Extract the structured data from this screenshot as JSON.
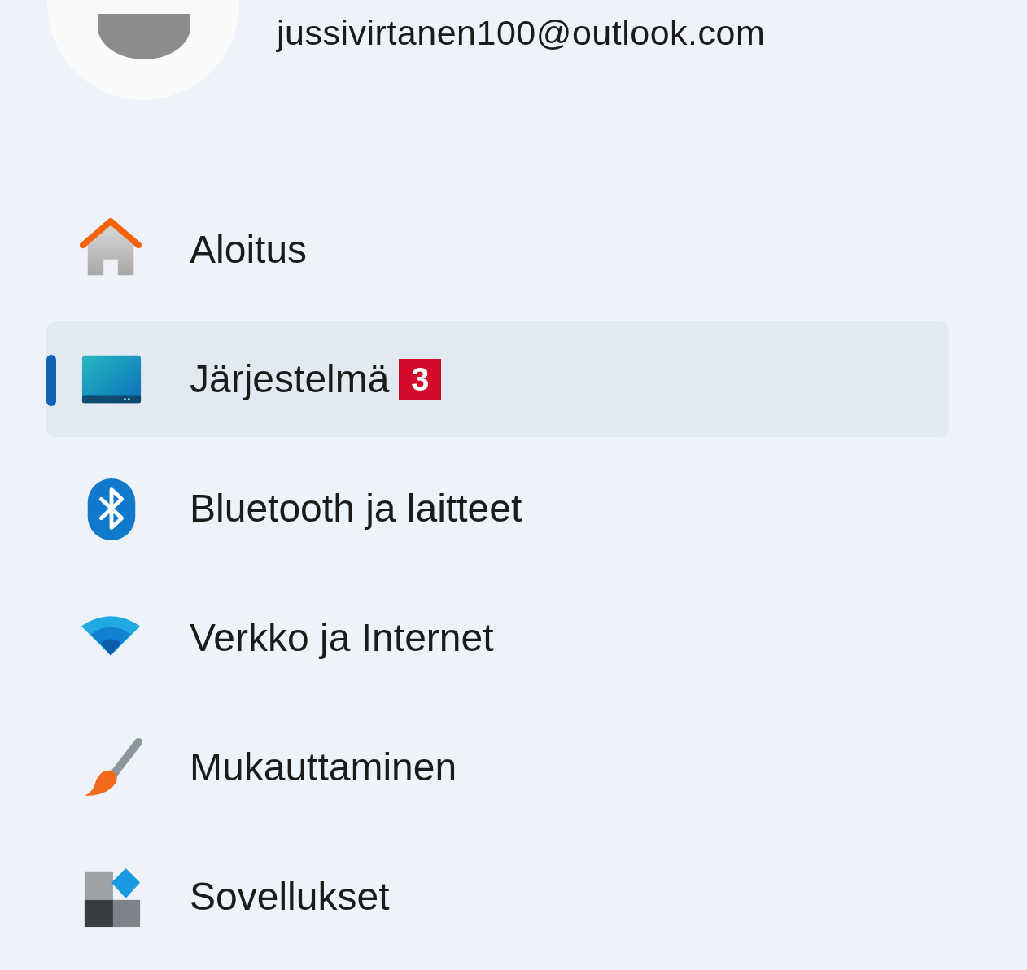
{
  "account": {
    "email": "jussivirtanen100@outlook.com"
  },
  "nav": {
    "items": [
      {
        "label": "Aloitus",
        "selected": false
      },
      {
        "label": "Järjestelmä",
        "selected": true,
        "badge": "3"
      },
      {
        "label": "Bluetooth ja laitteet",
        "selected": false
      },
      {
        "label": "Verkko ja Internet",
        "selected": false
      },
      {
        "label": "Mukauttaminen",
        "selected": false
      },
      {
        "label": "Sovellukset",
        "selected": false
      }
    ]
  }
}
